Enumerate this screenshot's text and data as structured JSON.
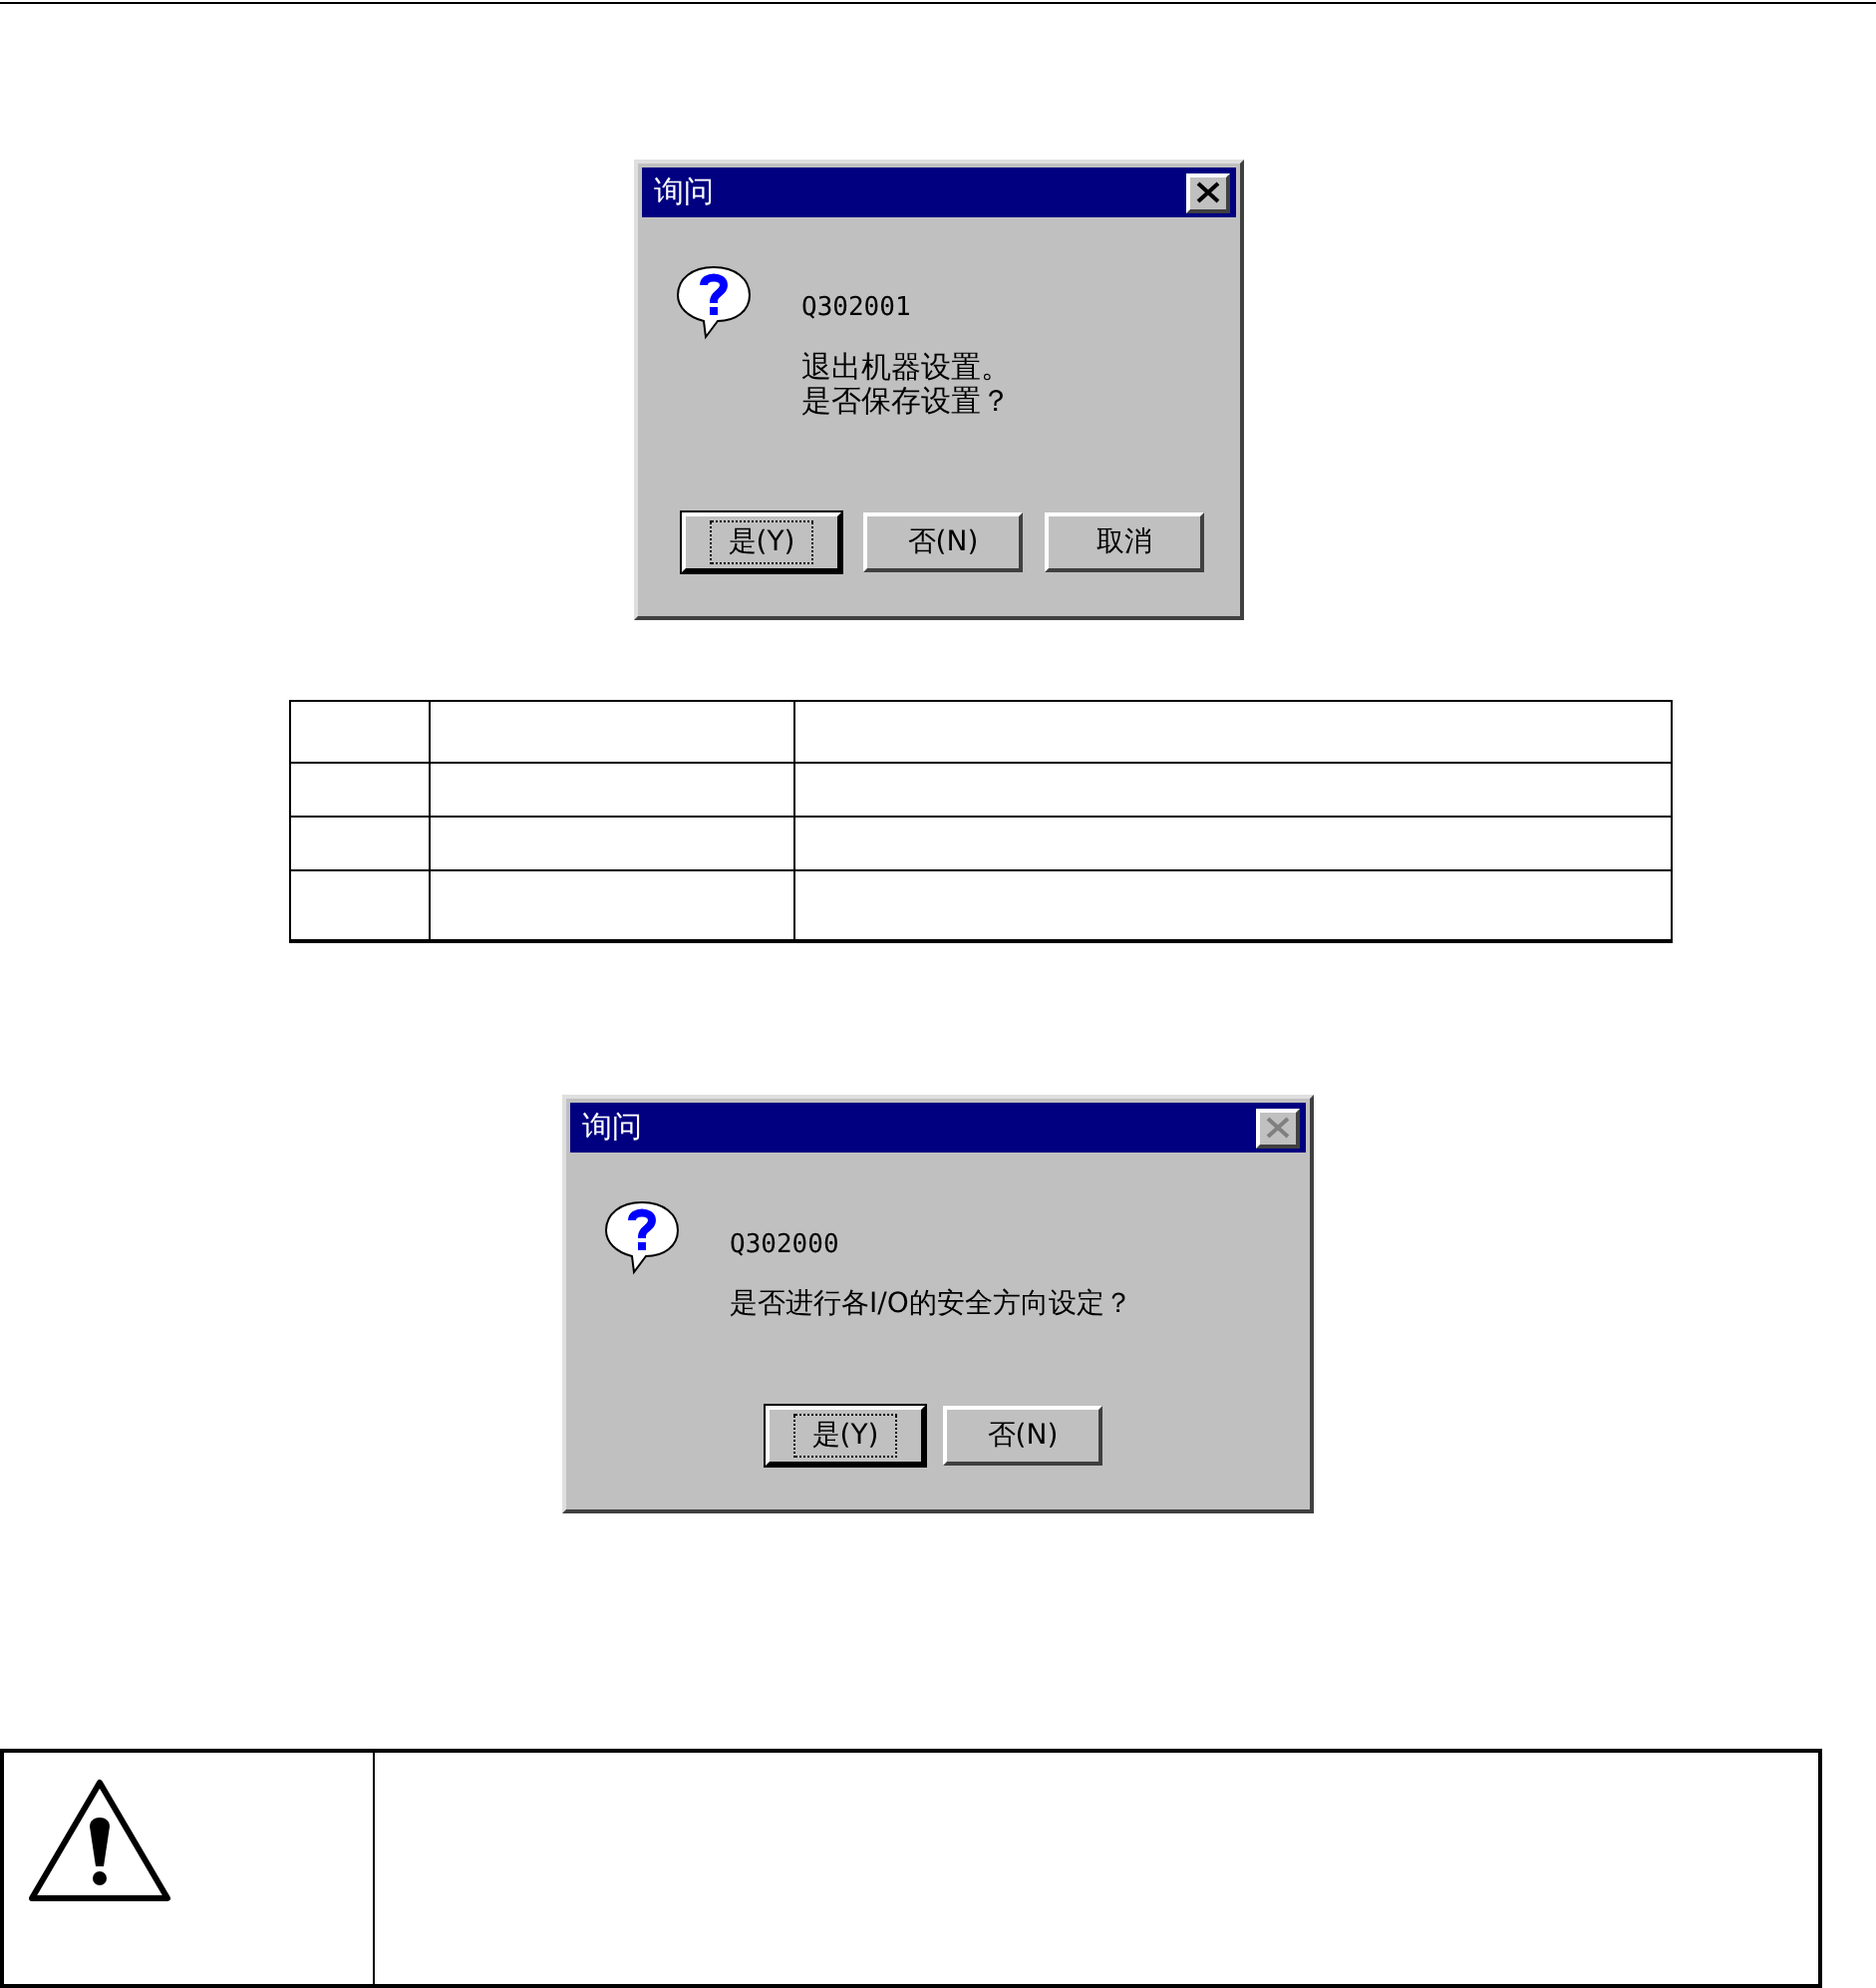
{
  "dialogs": [
    {
      "title": "询问",
      "close_disabled": false,
      "code": "Q302001",
      "message": [
        "退出机器设置。",
        "是否保存设置？"
      ],
      "buttons": [
        {
          "label": "是(Y)",
          "focused": true
        },
        {
          "label": "否(N)",
          "focused": false
        },
        {
          "label": "取消",
          "focused": false
        }
      ]
    },
    {
      "title": "询问",
      "close_disabled": true,
      "code": "Q302000",
      "message": [
        "是否进行各I/O的安全方向设定？"
      ],
      "buttons": [
        {
          "label": "是(Y)",
          "focused": true
        },
        {
          "label": "否(N)",
          "focused": false
        }
      ]
    }
  ]
}
